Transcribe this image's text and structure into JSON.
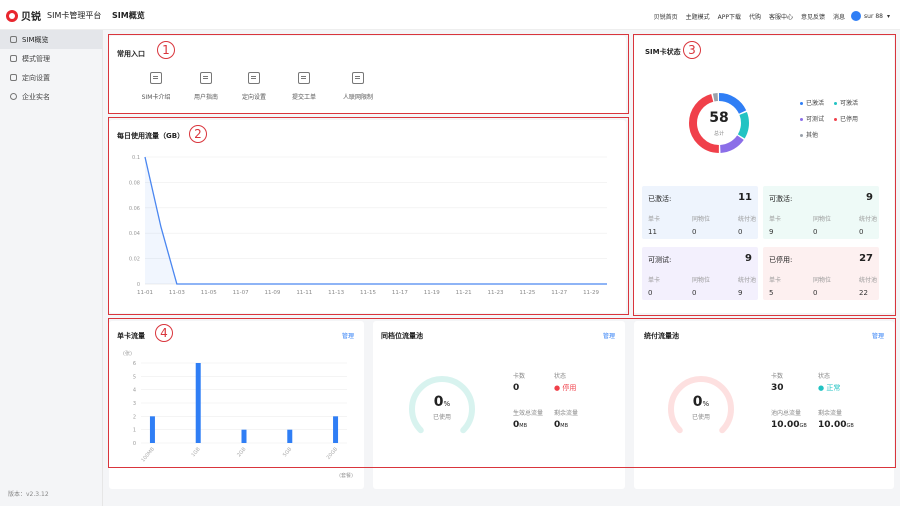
{
  "app": {
    "brand": "贝锐",
    "subtitle": "SIM卡管理平台",
    "page_heading": "SIM概览",
    "version": "版本：v2.3.12"
  },
  "topnav": {
    "items": [
      "贝锐首页",
      "主题模式",
      "APP下载",
      "代购",
      "客服中心",
      "意见反馈",
      "消息"
    ],
    "user": "sur        88",
    "caret": "▾"
  },
  "sidebar": {
    "items": [
      {
        "label": "SIM概览",
        "icon": "home-icon",
        "active": true
      },
      {
        "label": "模式管理",
        "icon": "grid-icon",
        "active": false
      },
      {
        "label": "定向设置",
        "icon": "apps-icon",
        "active": false
      },
      {
        "label": "企业实名",
        "icon": "user-icon",
        "active": false
      }
    ]
  },
  "annotations": [
    "1",
    "2",
    "3",
    "4"
  ],
  "quick_entry": {
    "title": "常用入口",
    "items": [
      {
        "label": "SIM卡介绍",
        "icon": "document-icon"
      },
      {
        "label": "用户指南",
        "icon": "guide-icon"
      },
      {
        "label": "定向设置",
        "icon": "settings-doc-icon"
      },
      {
        "label": "提交工单",
        "icon": "ticket-icon"
      },
      {
        "label": "人联网限制",
        "icon": "people-icon"
      }
    ]
  },
  "daily_usage": {
    "title": "每日使用流量（GB）",
    "chart_data": {
      "type": "line",
      "title": "每日使用流量（GB）",
      "x": [
        "11-01",
        "11-02",
        "11-03",
        "11-04",
        "11-05",
        "11-06",
        "11-07",
        "11-08",
        "11-09",
        "11-10",
        "11-11",
        "11-12",
        "11-13",
        "11-14",
        "11-15",
        "11-16",
        "11-17",
        "11-18",
        "11-19",
        "11-20",
        "11-21",
        "11-22",
        "11-23",
        "11-24",
        "11-25",
        "11-26",
        "11-27",
        "11-28",
        "11-29",
        "11-30"
      ],
      "x_tick_labels": [
        "11-01",
        "11-03",
        "11-05",
        "11-07",
        "11-09",
        "11-11",
        "11-13",
        "11-15",
        "11-17",
        "11-19",
        "11-21",
        "11-23",
        "11-25",
        "11-27",
        "11-29"
      ],
      "series": [
        {
          "values": [
            0.1,
            0.045,
            0,
            0,
            0,
            0,
            0,
            0,
            0,
            0,
            0,
            0,
            0,
            0,
            0,
            0,
            0,
            0,
            0,
            0,
            0,
            0,
            0,
            0,
            0,
            0,
            0,
            0,
            0,
            0
          ]
        }
      ],
      "y_tick_labels": [
        "0",
        "0.02",
        "0.04",
        "0.06",
        "0.08",
        "0.1"
      ],
      "ylim": [
        0,
        0.1
      ],
      "grid": true,
      "color": "#4a86f0"
    }
  },
  "sim_status": {
    "title": "SIM卡状态",
    "total": "58",
    "total_label": "总计",
    "donut": [
      {
        "name": "已激活",
        "value": 11,
        "color": "#2f7ef5"
      },
      {
        "name": "可激活",
        "value": 9,
        "color": "#22c3c3"
      },
      {
        "name": "可测试",
        "value": 9,
        "color": "#8b6ee8"
      },
      {
        "name": "已停用",
        "value": 27,
        "color": "#f0404a"
      },
      {
        "name": "其他",
        "value": 2,
        "color": "#9aa1ab"
      }
    ],
    "cards": [
      {
        "name": "已激活:",
        "total": "11",
        "cols": [
          "单卡",
          "同物位",
          "统付池"
        ],
        "vals": [
          "11",
          "0",
          "0"
        ],
        "bg": "#eef4fd"
      },
      {
        "name": "可激活:",
        "total": "9",
        "cols": [
          "单卡",
          "同物位",
          "统付池"
        ],
        "vals": [
          "9",
          "0",
          "0"
        ],
        "bg": "#eefaf7"
      },
      {
        "name": "可测试:",
        "total": "9",
        "cols": [
          "单卡",
          "同物位",
          "统付池"
        ],
        "vals": [
          "0",
          "0",
          "9"
        ],
        "bg": "#f3f0fd"
      },
      {
        "name": "已停用:",
        "total": "27",
        "cols": [
          "单卡",
          "同物位",
          "统付池"
        ],
        "vals": [
          "5",
          "0",
          "22"
        ],
        "bg": "#fdf0f0"
      }
    ]
  },
  "single_card": {
    "title": "单卡流量",
    "manage": "管理",
    "chart_data": {
      "type": "bar",
      "title": "单卡流量",
      "categories": [
        "100MB",
        "",
        "1GB",
        "",
        "2GB",
        "",
        "5GB",
        "",
        "20GB"
      ],
      "values": [
        2,
        0,
        6,
        0,
        1,
        0,
        1,
        0,
        2
      ],
      "y_unit": "(张)",
      "x_unit": "(套餐)",
      "y_tick_labels": [
        "0",
        "1",
        "2",
        "3",
        "4",
        "5",
        "6"
      ],
      "ylim": [
        0,
        6
      ],
      "grid": true,
      "color": "#2f7ef5"
    }
  },
  "pool_same": {
    "title": "同档位流量池",
    "manage": "管理",
    "percent": "0",
    "percent_unit": "%",
    "used_label": "已使用",
    "card_count_label": "卡数",
    "card_count": "0",
    "status_label": "状态",
    "status": "停用",
    "status_color": "#f0404a",
    "total_label": "生效总流量",
    "total": "0",
    "total_unit": "MB",
    "remain_label": "剩余流量",
    "remain": "0",
    "remain_unit": "MB",
    "gauge_color": "#d8f3ef"
  },
  "pool_unified": {
    "title": "统付流量池",
    "manage": "管理",
    "percent": "0",
    "percent_unit": "%",
    "used_label": "已使用",
    "card_count_label": "卡数",
    "card_count": "30",
    "status_label": "状态",
    "status": "正常",
    "status_color": "#22c3c3",
    "total_label": "池内总流量",
    "total": "10.00",
    "total_unit": "GB",
    "remain_label": "剩余流量",
    "remain": "10.00",
    "remain_unit": "GB",
    "gauge_color": "#fde0e0"
  }
}
